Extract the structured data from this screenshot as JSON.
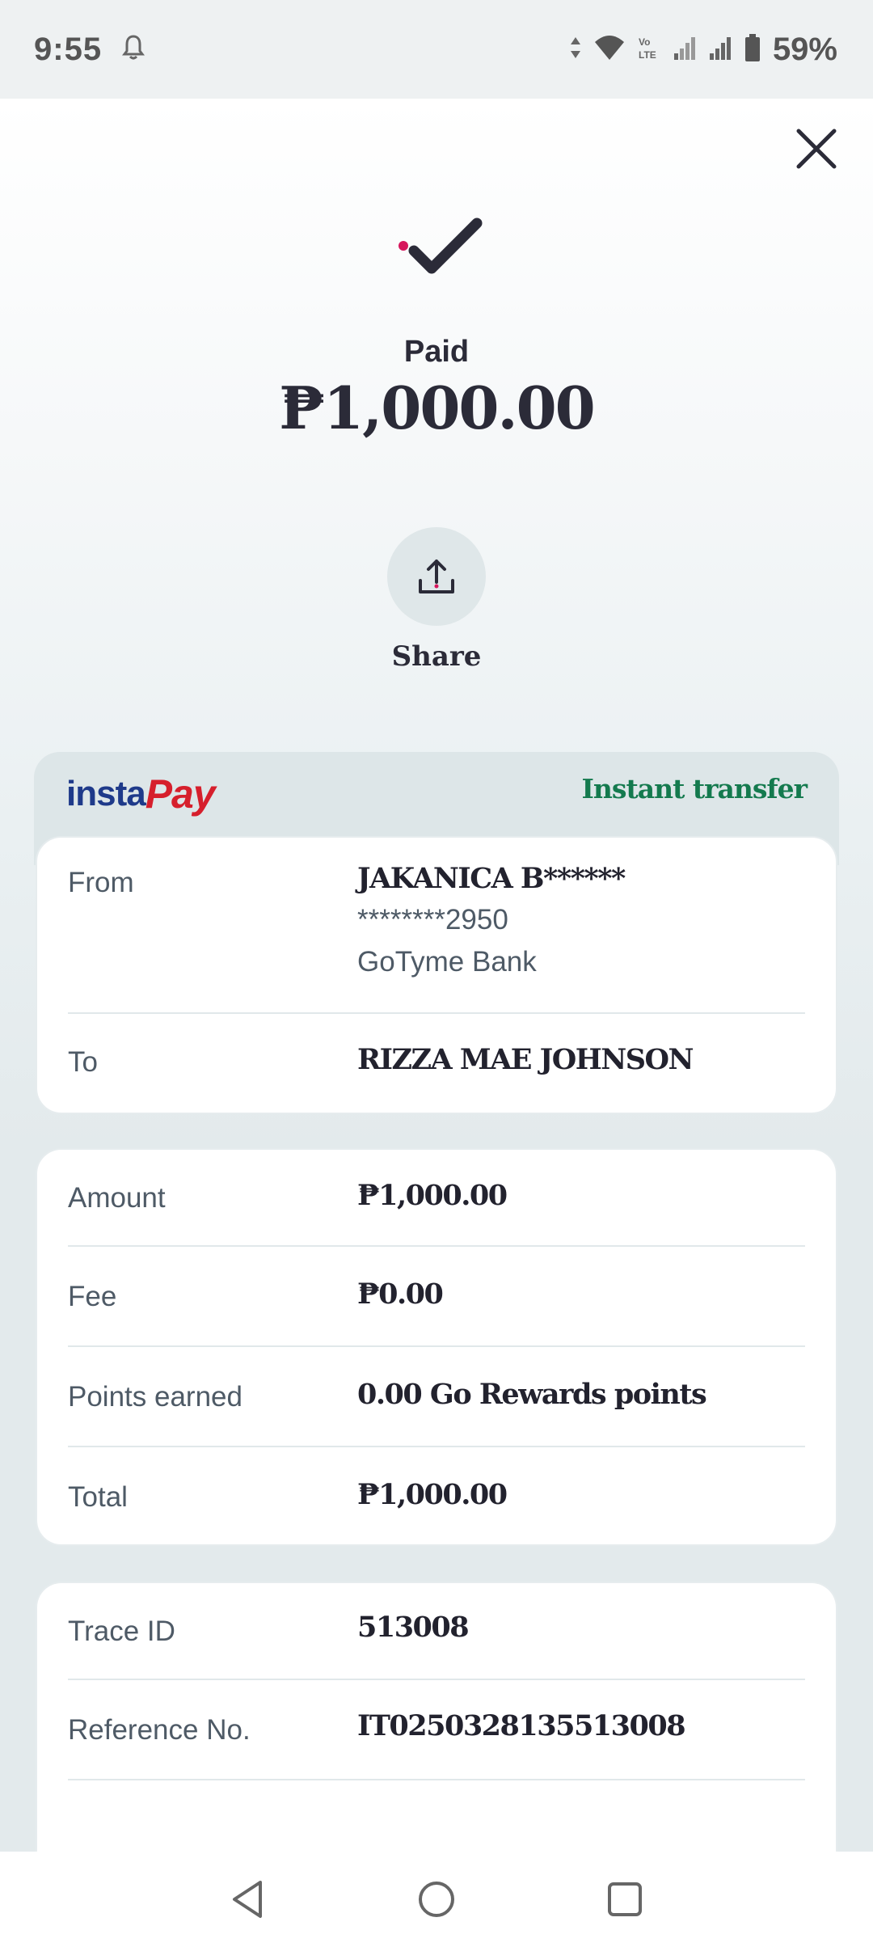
{
  "status_bar": {
    "time": "9:55",
    "battery": "59%",
    "icons": [
      "bell-icon",
      "data-arrows-icon",
      "wifi-icon",
      "volte-icon",
      "signal-icon",
      "signal-icon",
      "battery-icon"
    ]
  },
  "receipt": {
    "status_label": "Paid",
    "amount": "₱1,000.00",
    "share_label": "Share",
    "provider_logo": {
      "part1": "insta",
      "part2": "Pay"
    },
    "transfer_type": "Instant transfer",
    "from_label": "From",
    "from_name": "JAKANICA B******",
    "from_account": "********2950",
    "from_bank": "GoTyme Bank",
    "to_label": "To",
    "to_name": "RIZZA MAE JOHNSON",
    "amount_label": "Amount",
    "amount_value": "₱1,000.00",
    "fee_label": "Fee",
    "fee_value": "₱0.00",
    "points_label": "Points earned",
    "points_value": "0.00 Go Rewards points",
    "total_label": "Total",
    "total_value": "₱1,000.00",
    "trace_label": "Trace ID",
    "trace_value": "513008",
    "reference_label": "Reference No.",
    "reference_value": "IT0250328135513008"
  },
  "colors": {
    "accent_dot": "#d6165c",
    "instant_transfer": "#147a4e",
    "logo_blue": "#1e3a8a",
    "logo_red": "#d61f2c"
  }
}
